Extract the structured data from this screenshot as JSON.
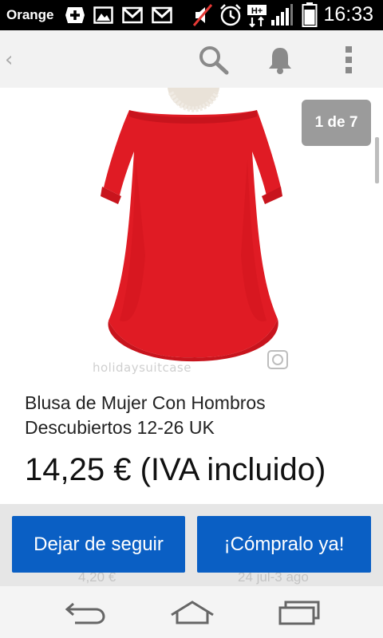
{
  "status_bar": {
    "carrier": "Orange",
    "time": "16:33",
    "icons": [
      "plus-icon",
      "image-icon",
      "gmail-icon",
      "gmail-icon",
      "mute-icon",
      "alarm-icon",
      "hplus-data-icon",
      "signal-icon",
      "battery-icon"
    ]
  },
  "app_bar": {
    "icons": [
      "back-chevron-icon",
      "search-icon",
      "notification-bell-icon",
      "overflow-menu-icon"
    ]
  },
  "gallery": {
    "counter": "1 de 7",
    "watermark": "holidaysuitcase"
  },
  "listing": {
    "title": "Blusa de Mujer Con Hombros Descubiertos 12-26 UK",
    "price": "14,25 € (IVA incluido)",
    "shipping_partial": "4,20 €",
    "delivery_partial": "24 jul-3 ago"
  },
  "actions": {
    "unfollow_label": "Dejar de seguir",
    "buy_label": "¡Cómpralo ya!"
  },
  "colors": {
    "status_bar": "#000000",
    "app_bar": "#f2f2f2",
    "button_blue": "#0a5fc4",
    "blouse_red": "#e01b24",
    "counter_badge": "#9b9b9b"
  }
}
